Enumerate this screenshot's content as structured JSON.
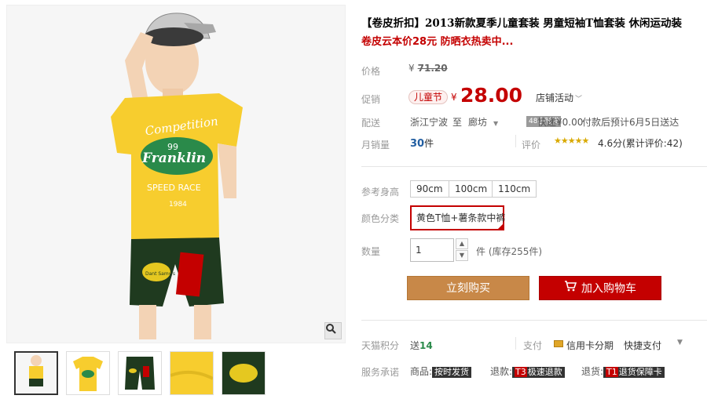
{
  "product": {
    "title": "【卷皮折扣】2013新款夏季儿童套装 男童短袖T恤套装 休闲运动装",
    "subtitle": "卷皮云本价28元 防晒衣热卖中..."
  },
  "gallery": {
    "shirt_text_1": "Competition",
    "shirt_text_2": "99",
    "shirt_text_3": "Franklin",
    "shirt_text_4": "SPEED RACE",
    "shirt_text_5": "1984",
    "patch_text": "Dant Samy's",
    "zoom_icon": "search-icon",
    "thumbnails": [
      {
        "name": "thumb-full-outfit",
        "selected": true
      },
      {
        "name": "thumb-shirt",
        "selected": false
      },
      {
        "name": "thumb-pants",
        "selected": false
      },
      {
        "name": "thumb-shirt-detail",
        "selected": false
      },
      {
        "name": "thumb-patch-detail",
        "selected": false
      }
    ]
  },
  "price": {
    "label": "价格",
    "currency": "¥",
    "original": "71.20",
    "promo_label": "促销",
    "promo_badge": "儿童节",
    "current": "28.00",
    "store_promo": "店铺活动",
    "store_promo_chevron": "chevron-down-icon"
  },
  "shipping": {
    "label": "配送",
    "from": "浙江宁波",
    "to_word": "至",
    "to": "廊坊",
    "time_tag": "48小时发",
    "express": "快递¥0.00",
    "eta": "付款后预计6月5日送达"
  },
  "sales": {
    "label": "月销量",
    "count": "30",
    "unit": "件",
    "rating_label": "评价",
    "stars": "★★★★★",
    "rating": "4.6分(累计评价:42)"
  },
  "options": {
    "size_label": "参考身高",
    "sizes": [
      "90cm",
      "100cm",
      "110cm"
    ],
    "color_label": "颜色分类",
    "selected_color": "黄色T恤+薯条款中裤",
    "qty_label": "数量",
    "qty_value": "1",
    "qty_unit": "件",
    "stock": "(库存255件)"
  },
  "actions": {
    "buy": "立刻购买",
    "cart": "加入购物车",
    "cart_icon": "cart-icon"
  },
  "extra": {
    "points_label": "天猫积分",
    "points_send": "送",
    "points_value": "14",
    "pay_label": "支付",
    "pay_card": "信用卡分期",
    "pay_fast": "快捷支付",
    "service_label": "服务承诺",
    "svc1_prefix": "商品:",
    "svc1_tag": "按时发货",
    "svc2_prefix": "退款:",
    "svc2_t": "T3",
    "svc2_tag": "极速退款",
    "svc3_prefix": "退货:",
    "svc3_t": "T1",
    "svc3_tag": "退货保障卡"
  },
  "colors": {
    "accent": "#c40000",
    "buy_button": "#c88848",
    "link": "#225ea1",
    "shirt": "#f7cd2e",
    "shorts": "#1f3a1f"
  }
}
